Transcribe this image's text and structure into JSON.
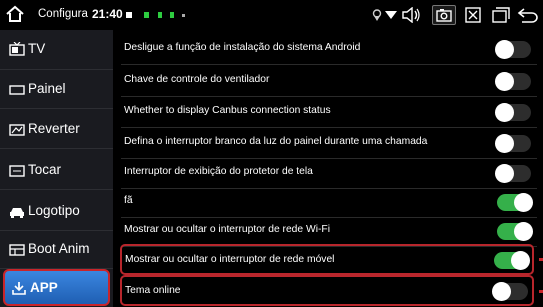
{
  "status_bar": {
    "app_name": "Configura",
    "time": "21:40"
  },
  "sidebar": {
    "items": [
      {
        "label": "TV",
        "icon": "tv-icon",
        "active": false
      },
      {
        "label": "Painel",
        "icon": "panel-icon",
        "active": false
      },
      {
        "label": "Reverter",
        "icon": "reverse-camera-icon",
        "active": false
      },
      {
        "label": "Tocar",
        "icon": "touch-icon",
        "active": false
      },
      {
        "label": "Logotipo",
        "icon": "car-logo-icon",
        "active": false
      },
      {
        "label": "Boot Anim",
        "icon": "boot-anim-icon",
        "active": false
      },
      {
        "label": "APP",
        "icon": "app-icon",
        "active": true
      }
    ]
  },
  "settings": [
    {
      "label": "Desligue a função de instalação do sistema Android",
      "on": false
    },
    {
      "label": "Chave de controle do ventilador",
      "on": false
    },
    {
      "label": "Whether to display Canbus connection status",
      "on": false
    },
    {
      "label": "Defina o interruptor branco da luz do painel durante uma chamada",
      "on": false
    },
    {
      "label": "Interruptor de exibição do protetor de tela",
      "on": false
    },
    {
      "label": "fã",
      "on": true
    },
    {
      "label": "Mostrar ou ocultar o interruptor de rede Wi-Fi",
      "on": true
    },
    {
      "label": "Mostrar ou ocultar o interruptor de rede móvel",
      "on": true,
      "highlighted": true
    },
    {
      "label": "Tema online",
      "on": false,
      "highlighted": true
    }
  ],
  "colors": {
    "active_tab": "#2f74cc",
    "toggle_on": "#35b04a",
    "highlight_border": "#b8262c"
  }
}
